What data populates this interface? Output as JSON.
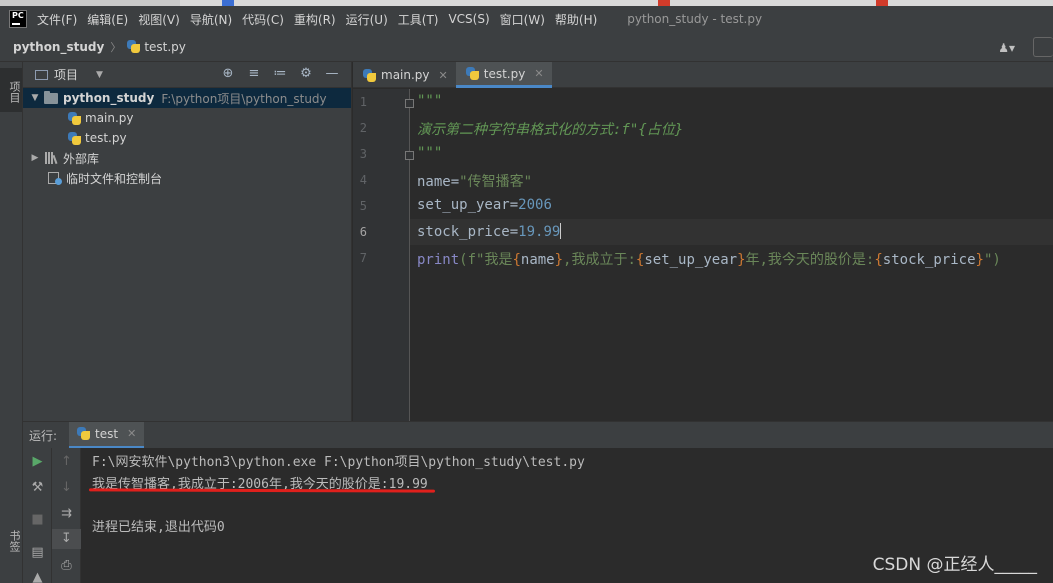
{
  "app": {
    "logo_text": "PC",
    "window_title": "python_study - test.py"
  },
  "menu": {
    "items": [
      "文件(F)",
      "编辑(E)",
      "视图(V)",
      "导航(N)",
      "代码(C)",
      "重构(R)",
      "运行(U)",
      "工具(T)",
      "VCS(S)",
      "窗口(W)",
      "帮助(H)"
    ]
  },
  "navbar": {
    "project": "python_study",
    "separator": "〉",
    "file": "test.py",
    "user_icon": "user-icon"
  },
  "left_strip": {
    "project_tab": "项目",
    "bookmarks_tab": "书签"
  },
  "project_panel": {
    "title": "项目",
    "tools": [
      "target-icon",
      "expand-all-icon",
      "collapse-all-icon",
      "gear-icon",
      "minimize-icon"
    ],
    "tree": {
      "root_name": "python_study",
      "root_path": "F:\\python项目\\python_study",
      "files": [
        "main.py",
        "test.py"
      ],
      "external_libs": "外部库",
      "scratches": "临时文件和控制台"
    }
  },
  "editor": {
    "tabs": [
      {
        "label": "main.py",
        "active": false
      },
      {
        "label": "test.py",
        "active": true
      }
    ],
    "current_line": 6,
    "lines": {
      "l1": "\"\"\"",
      "l2": "演示第二种字符串格式化的方式:f\"{占位}",
      "l3": "\"\"\"",
      "l4_var": "name",
      "l4_val": "\"传智播客\"",
      "l5_var": "set_up_year",
      "l5_val": "2006",
      "l6_var": "stock_price",
      "l6_val": "19.99",
      "l7_fn": "print",
      "l7_p1": "(f\"我是",
      "l7_v1": "name",
      "l7_p2": ",我成立于:",
      "l7_v2": "set_up_year",
      "l7_p3": "年,我今天的股价是:",
      "l7_v3": "stock_price",
      "l7_p4": "\")"
    },
    "line_numbers": [
      "1",
      "2",
      "3",
      "4",
      "5",
      "6",
      "7"
    ]
  },
  "run": {
    "label": "运行:",
    "tab": "test",
    "output": [
      "F:\\网安软件\\python3\\python.exe F:\\python项目\\python_study\\test.py",
      "我是传智播客,我成立于:2006年,我今天的股价是:19.99",
      "进程已结束,退出代码0"
    ]
  },
  "watermark": "CSDN @正经人_____",
  "colors": {
    "background": "#2b2b2b",
    "panel": "#3c3f41",
    "accent": "#4a88c7",
    "annotation_underline": "#e0201c",
    "doc_comment": "#629755",
    "string": "#6a8759",
    "number": "#6897bb"
  }
}
